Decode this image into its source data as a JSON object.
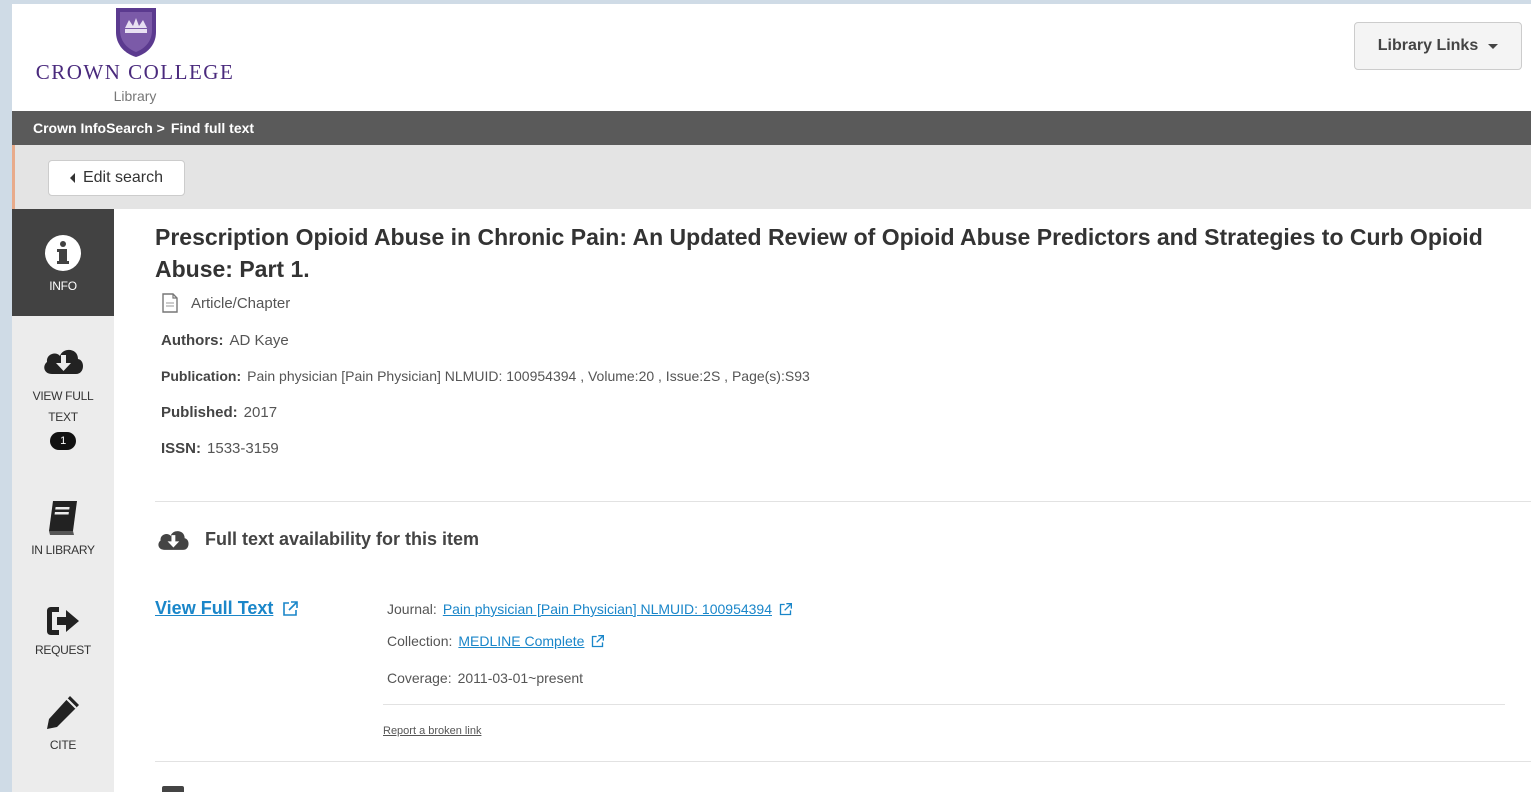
{
  "header": {
    "college_name": "CROWN COLLEGE",
    "college_sub": "Library",
    "library_links_label": "Library Links"
  },
  "breadcrumb": {
    "home": "Crown InfoSearch >",
    "current": "Find full text"
  },
  "edit_search_label": "Edit search",
  "sidebar": {
    "items": [
      {
        "label": "INFO",
        "icon": "info-icon",
        "active": true
      },
      {
        "label_line1": "VIEW FULL",
        "label_line2": "TEXT",
        "icon": "cloud-download-icon",
        "badge": "1"
      },
      {
        "label": "IN LIBRARY",
        "icon": "book-icon"
      },
      {
        "label": "REQUEST",
        "icon": "sign-out-icon"
      },
      {
        "label": "CITE",
        "icon": "pencil-icon"
      }
    ]
  },
  "record": {
    "title": "Prescription Opioid Abuse in Chronic Pain: An Updated Review of Opioid Abuse Predictors and Strategies to Curb Opioid Abuse: Part 1.",
    "type": "Article/Chapter",
    "authors_label": "Authors:",
    "authors": "AD Kaye",
    "publication_label": "Publication:",
    "publication": "Pain physician [Pain Physician] NLMUID: 100954394 , Volume:20 , Issue:2S , Page(s):S93",
    "published_label": "Published:",
    "published": "2017",
    "issn_label": "ISSN:",
    "issn": "1533-3159"
  },
  "availability": {
    "heading": "Full text availability for this item",
    "view_full_text": "View Full Text",
    "journal_label": "Journal:",
    "journal": "Pain physician [Pain Physician] NLMUID: 100954394",
    "collection_label": "Collection:",
    "collection": "MEDLINE Complete",
    "coverage_label": "Coverage:",
    "coverage": "2011-03-01~present",
    "report_link": "Report a broken link"
  },
  "colors": {
    "brand_purple": "#4a2a7d",
    "link_blue": "#1a86c9",
    "crumb_bar": "#5a5a5a",
    "accent_orange": "#e8672c"
  }
}
